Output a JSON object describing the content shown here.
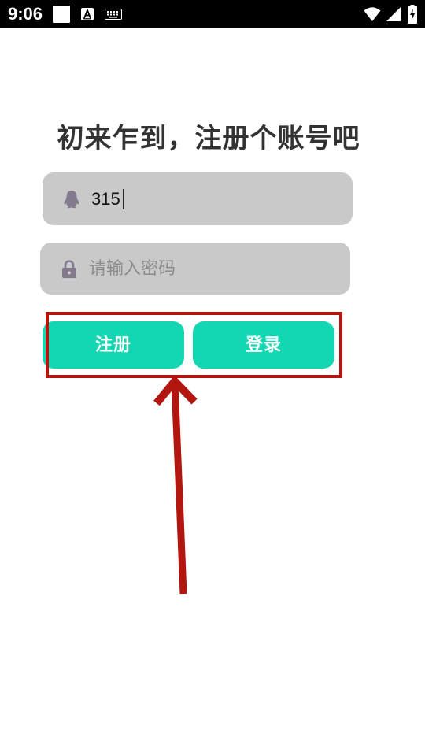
{
  "status_bar": {
    "time": "9:06",
    "icons": [
      "white-square-icon",
      "a-box-icon",
      "keyboard-icon",
      "wifi-icon",
      "cell-signal-icon",
      "battery-icon"
    ]
  },
  "title": "初来乍到，注册个账号吧",
  "username_field": {
    "icon": "qq-penguin-icon",
    "value": "315"
  },
  "password_field": {
    "icon": "lock-icon",
    "placeholder": "请输入密码",
    "value": ""
  },
  "buttons": {
    "register_label": "注册",
    "login_label": "登录"
  },
  "colors": {
    "accent": "#13d6b3",
    "field_bg": "#c9c9c9",
    "annotation": "#b3160f",
    "icon_gray": "#847a8e"
  }
}
